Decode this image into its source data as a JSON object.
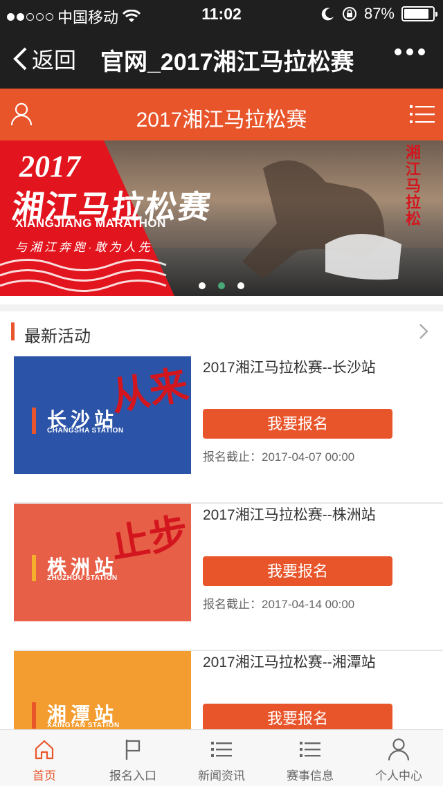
{
  "status_bar": {
    "carrier": "中国移动",
    "time": "11:02",
    "battery": "87%",
    "battery_level": 0.87
  },
  "nav": {
    "back_label": "返回",
    "title": "官网_2017湘江马拉松赛"
  },
  "site_header": {
    "title": "2017湘江马拉松赛",
    "left_icon": "user-icon",
    "right_icon": "menu-icon"
  },
  "banner": {
    "year": "2017",
    "cn_title": "湘江马拉松赛",
    "en_title": "XIANGJIANG MARATHON",
    "slogan": "与湘江奔跑·敢为人先",
    "vertical_text": "湘江马拉松",
    "slide_count": 3,
    "active_slide": 2
  },
  "section": {
    "title": "最新活动"
  },
  "events": [
    {
      "title": "2017湘江马拉松赛--长沙站",
      "button": "我要报名",
      "deadline": "报名截止：2017-04-07 00:00",
      "thumb_cn": "长沙站",
      "thumb_en": "CHANGSHA STATION",
      "thumb_brush": "从来",
      "thumb_bg": "#2b54a8",
      "thumb_bar": "#e9552b",
      "thumb_brush_color": "#d3161e"
    },
    {
      "title": "2017湘江马拉松赛--株洲站",
      "button": "我要报名",
      "deadline": "报名截止：2017-04-14 00:00",
      "thumb_cn": "株洲站",
      "thumb_en": "ZHUZHOU STATION",
      "thumb_brush": "止步",
      "thumb_bg": "#e85f47",
      "thumb_bar": "#f4b02a",
      "thumb_brush_color": "#d3161e"
    },
    {
      "title": "2017湘江马拉松赛--湘潭站",
      "button": "我要报名",
      "deadline": "",
      "thumb_cn": "湘潭站",
      "thumb_en": "XAINGTAN STATION",
      "thumb_brush": "",
      "thumb_bg": "#f39c2f",
      "thumb_bar": "#e9552b",
      "thumb_brush_color": "#d3161e"
    }
  ],
  "tabs": [
    {
      "label": "首页",
      "icon": "home-icon",
      "active": true
    },
    {
      "label": "报名入口",
      "icon": "flag-icon",
      "active": false
    },
    {
      "label": "新闻资讯",
      "icon": "list-icon",
      "active": false
    },
    {
      "label": "赛事信息",
      "icon": "list-icon",
      "active": false
    },
    {
      "label": "个人中心",
      "icon": "user-icon",
      "active": false
    }
  ],
  "colors": {
    "accent": "#e9552b",
    "dark_bar": "#1f1f1f",
    "active_dot": "#4aa97a"
  }
}
